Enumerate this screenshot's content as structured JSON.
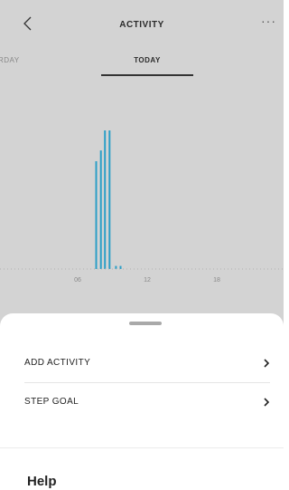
{
  "header": {
    "title": "ACTIVITY",
    "back_icon": "chevron-left-icon",
    "more_label": "···"
  },
  "tabs": [
    {
      "label": "RDAY",
      "selected": false
    },
    {
      "label": "TODAY",
      "selected": true
    }
  ],
  "chart_data": {
    "type": "bar",
    "x_ticks": [
      "06",
      "12",
      "18"
    ],
    "bar_color": "#2b9fc7",
    "bars": [
      {
        "hour": 7.6,
        "value": 0.7
      },
      {
        "hour": 8.0,
        "value": 0.77
      },
      {
        "hour": 8.35,
        "value": 0.9
      },
      {
        "hour": 8.75,
        "value": 0.9
      },
      {
        "hour": 9.3,
        "value": 0.02
      },
      {
        "hour": 9.7,
        "value": 0.02
      }
    ]
  },
  "sheet": {
    "items": [
      {
        "label": "ADD ACTIVITY",
        "icon": "chevron-right-icon"
      },
      {
        "label": "STEP GOAL",
        "icon": "chevron-right-icon"
      }
    ],
    "help_heading": "Help"
  },
  "colors": {
    "overlay_bg": "#d3d3d3",
    "accent": "#2b9fc7",
    "sheet_bg": "#ffffff"
  }
}
